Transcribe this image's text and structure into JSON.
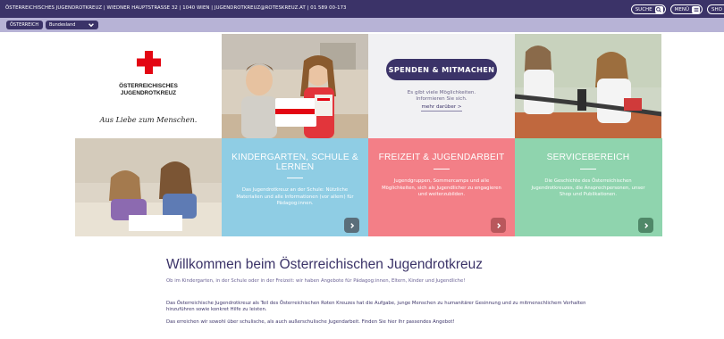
{
  "topbar": {
    "text": "ÖSTERREICHISCHES JUGENDROTKREUZ | WIEDNER HAUPTSTRASSE 32 | 1040 WIEN | JUGENDROTKREUZ@ROTESKREUZ.AT | 01 589 00-173",
    "search_label": "SUCHE",
    "menu_label": "MENÜ",
    "shop_label": "SHO"
  },
  "subbar": {
    "land_label": "ÖSTERREICH",
    "bundesland_label": "Bundesland"
  },
  "logo": {
    "line1": "ÖSTERREICHISCHES",
    "line2": "JUGENDROTKREUZ",
    "slogan": "Aus Liebe zum Menschen."
  },
  "spenden": {
    "button_label": "SPENDEN & MITMACHEN",
    "text1": "Es gibt viele Möglichkeiten.",
    "text2": "Informieren Sie sich.",
    "link": "mehr darüber >"
  },
  "tiles": {
    "kindergarten": {
      "title": "KINDERGARTEN, SCHULE & LERNEN",
      "body": "Das Jugendrotkreuz an der Schule: Nützliche Materialien und alle Informationen (vor allem) für Pädagog:innen."
    },
    "freizeit": {
      "title": "FREIZEIT & JUGENDARBEIT",
      "body": "Jugendgruppen, Sommercamps und alle Möglichkeiten, sich als Jugendlicher zu engagieren und weiterzubilden."
    },
    "service": {
      "title": "SERVICEBEREICH",
      "body": "Die Geschichte des Österreichischen Jugendrotkreuzes, die Ansprechpersonen, unser Shop und Publikationen."
    }
  },
  "welcome": {
    "heading": "Willkommen beim Österreichischen Jugendrotkreuz",
    "intro": "Ob im Kindergarten, in der Schule oder in der Freizeit: wir haben Angebote für Pädagog:innen, Eltern, Kinder und Jugendliche!",
    "para1": "Das Österreichische Jugendrotkreuz als Teil des Österreichischen Roten Kreuzes hat die Aufgabe, junge Menschen zu humanitärer Gesinnung und zu mitmenschlichem Verhalten hinzuführen sowie konkret Hilfe zu leisten.",
    "para2": "Das erreichen wir sowohl über schulische, als auch außerschulische Jugendarbeit. Finden Sie hier Ihr passendes Angebot!"
  },
  "colors": {
    "brand_dark": "#3b3368",
    "brand_light": "#b7b3d6",
    "red": "#e30613",
    "kindergarten": "#8fcde4",
    "freizeit": "#f37f87",
    "service": "#8fd4ae"
  },
  "icons": [
    "search-icon",
    "menu-icon",
    "chevron-down-icon",
    "red-cross-icon",
    "arrow-right-icon"
  ]
}
